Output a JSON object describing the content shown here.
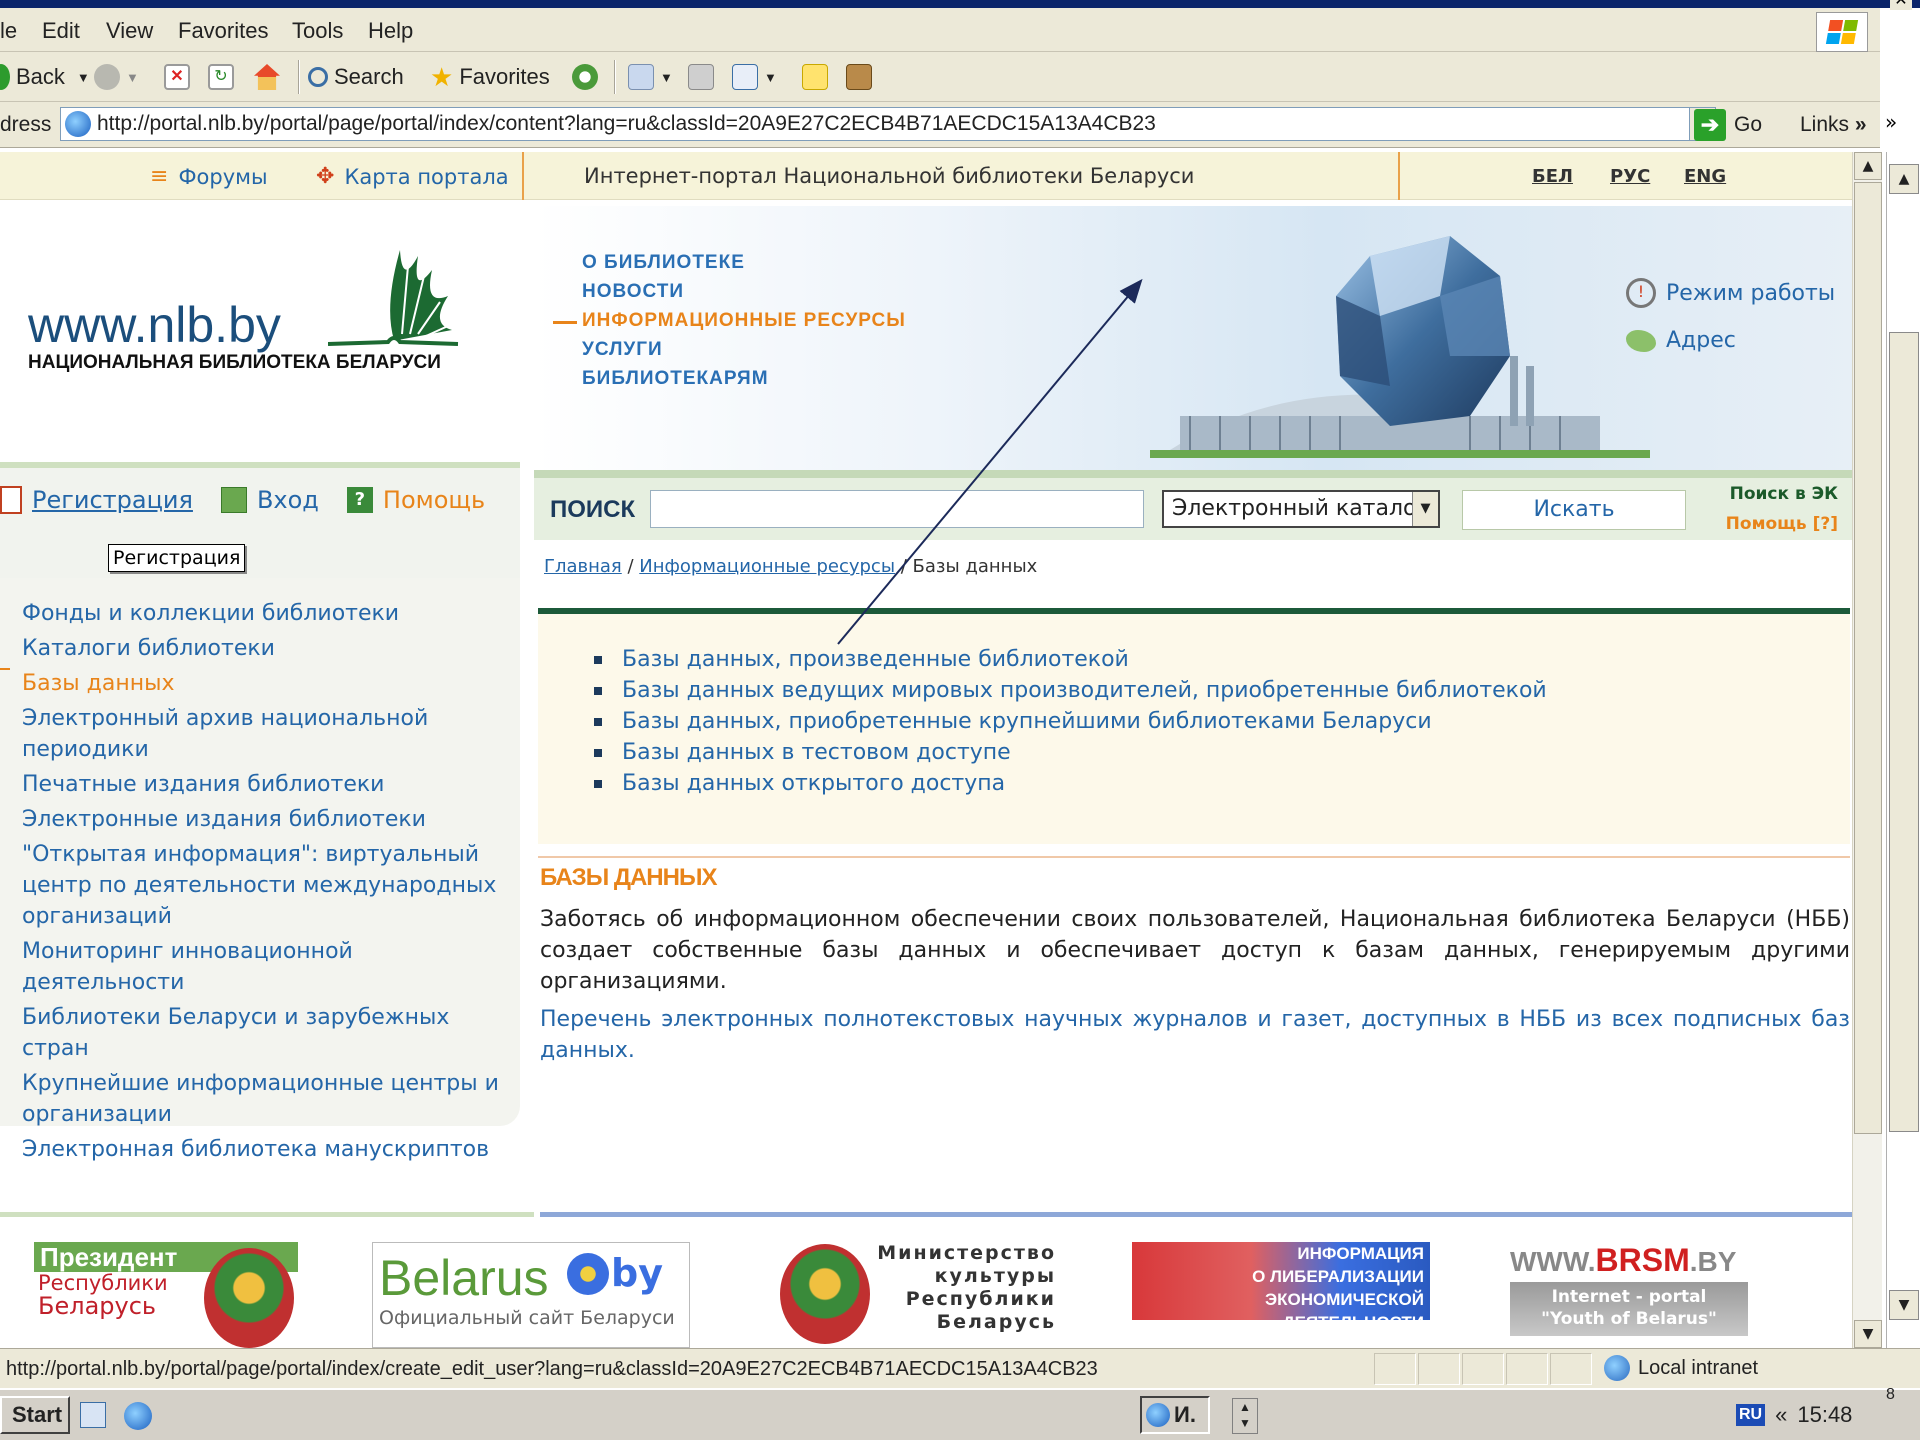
{
  "window": {
    "close_glyph": "✕"
  },
  "menu": [
    "le",
    "Edit",
    "View",
    "Favorites",
    "Tools",
    "Help"
  ],
  "toolbar": {
    "back_label": "Back",
    "search_label": "Search",
    "favorites_label": "Favorites"
  },
  "address": {
    "label": "dress",
    "url": "http://portal.nlb.by/portal/page/portal/index/content?lang=ru&classId=20A9E27C2ECB4B71AECDC15A13A4CB23",
    "go_label": "Go",
    "links_label": "Links",
    "chevron": "»"
  },
  "topnav": {
    "forums": "Форумы",
    "sitemap": "Карта портала",
    "portal_title": "Интернет-портал Национальной библиотеки Беларуси",
    "langs": [
      "БЕЛ",
      "РУС",
      "ENG"
    ]
  },
  "header": {
    "logo_text": "www.nlb.by",
    "logo_subtitle": "НАЦИОНАЛЬНАЯ БИБЛИОТЕКА БЕЛАРУСИ",
    "menu": [
      "О БИБЛИОТЕКЕ",
      "НОВОСТИ",
      "ИНФОРМАЦИОННЫЕ РЕСУРСЫ",
      "УСЛУГИ",
      "БИБЛИОТЕКАРЯМ"
    ],
    "active_menu": "ИНФОРМАЦИОННЫЕ РЕСУРСЫ",
    "work_hours": "Режим работы",
    "address": "Адрес"
  },
  "auth": {
    "register": "Регистрация",
    "login": "Вход",
    "help": "Помощь",
    "tooltip": "Регистрация"
  },
  "search": {
    "label": "ПОИСК",
    "input_value": "",
    "scope": "Электронный каталог",
    "button": "Искать",
    "ek_search": "Поиск в ЭК",
    "ek_help": "Помощь [?]"
  },
  "breadcrumb": {
    "home": "Главная",
    "resources": "Информационные ресурсы",
    "current": "Базы данных",
    "sep": " / "
  },
  "sidebar": {
    "items": [
      "Фонды и коллекции библиотеки",
      "Каталоги библиотеки",
      "Базы данных",
      "Электронный архив национальной периодики",
      "Печатные издания библиотеки",
      "Электронные издания библиотеки",
      "\"Открытая информация\": виртуальный центр по деятельности международных организаций",
      "Мониторинг инновационной деятельности",
      "Библиотеки Беларуси и зарубежных стран",
      "Крупнейшие информационные центры и организации",
      "Электронная библиотека манускриптов"
    ],
    "active_index": 2
  },
  "content": {
    "db_links": [
      "Базы данных, произведенные библиотекой",
      "Базы данных ведущих мировых производителей, приобретенные библиотекой",
      "Базы данных, приобретенные крупнейшими библиотеками Беларуси",
      "Базы данных в тестовом доступе",
      "Базы данных открытого доступа"
    ],
    "section_title": "БАЗЫ ДАННЫХ",
    "section_text": "Заботясь об информационном обеспечении своих пользователей, Национальная библиотека Беларуси (НББ) создает собственные базы данных и обеспечивает доступ к базам данных, генерируемым другими организациями.",
    "journals_link": "Перечень электронных полнотекстовых научных журналов и газет, доступных в НББ из всех подписных баз данных."
  },
  "footer_banners": {
    "president_line1": "Президент",
    "president_line2": "Республики",
    "president_line3": "Беларусь",
    "belarus_title": "Belarus",
    "belarus_by": "by",
    "belarus_sub": "Официальный сайт Беларуси",
    "ministry_line1": "Министерство",
    "ministry_line2": "культуры",
    "ministry_line3": "Республики",
    "ministry_line4": "Беларусь",
    "liberal_line1": "ИНФОРМАЦИЯ",
    "liberal_line2": "О ЛИБЕРАЛИЗАЦИИ",
    "liberal_line3": "ЭКОНОМИЧЕСКОЙ ДЕЯТЕЛЬНОСТИ",
    "brsm_line1": "WWW.",
    "brsm_line2": "BRSM",
    "brsm_line3": ".BY",
    "brsm_sub1": "Internet - portal",
    "brsm_sub2": "\"Youth of Belarus\""
  },
  "status": {
    "url": "http://portal.nlb.by/portal/page/portal/index/create_edit_user?lang=ru&classId=20A9E27C2ECB4B71AECDC15A13A4CB23",
    "zone": "Local intranet"
  },
  "taskbar": {
    "start": "Start",
    "task_label": "И.",
    "lang": "RU",
    "chevron": "«",
    "time": "15:48",
    "edge_digit": "8"
  },
  "colors": {
    "link": "#2466a8",
    "accent": "#e8841a",
    "dark_green": "#1c5a3a"
  }
}
